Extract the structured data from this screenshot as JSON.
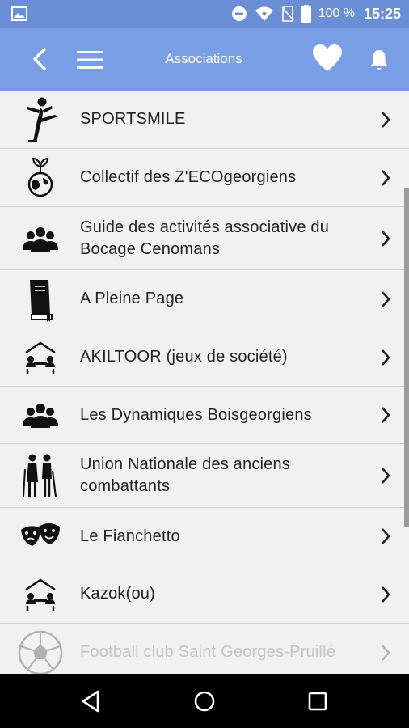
{
  "status_bar": {
    "battery": "100 %",
    "time": "15:25"
  },
  "app_bar": {
    "title": "Associations"
  },
  "list": {
    "items": [
      {
        "label": "SPORTSMILE",
        "icon": "kick-athlete-icon"
      },
      {
        "label": "Collectif des Z'ECOgeorgiens",
        "icon": "eco-globe-icon"
      },
      {
        "label": "Guide des activités associative du Bocage Cenomans",
        "icon": "group-people-icon"
      },
      {
        "label": "A Pleine Page",
        "icon": "book-icon"
      },
      {
        "label": "AKILTOOR (jeux de société)",
        "icon": "board-game-table-icon"
      },
      {
        "label": "Les Dynamiques Boisgeorgiens",
        "icon": "group-people-icon"
      },
      {
        "label": "Union Nationale des anciens combattants",
        "icon": "elderly-couple-icon"
      },
      {
        "label": "Le Fianchetto",
        "icon": "theater-masks-icon"
      },
      {
        "label": "Kazok(ou)",
        "icon": "board-game-table-icon"
      },
      {
        "label": "Football club Saint Georges-Pruillé",
        "icon": "soccer-ball-icon"
      }
    ]
  },
  "colors": {
    "status_bar": "#6b8fd6",
    "app_bar": "#7a9ee6",
    "list_bg": "#f1f1f1"
  }
}
